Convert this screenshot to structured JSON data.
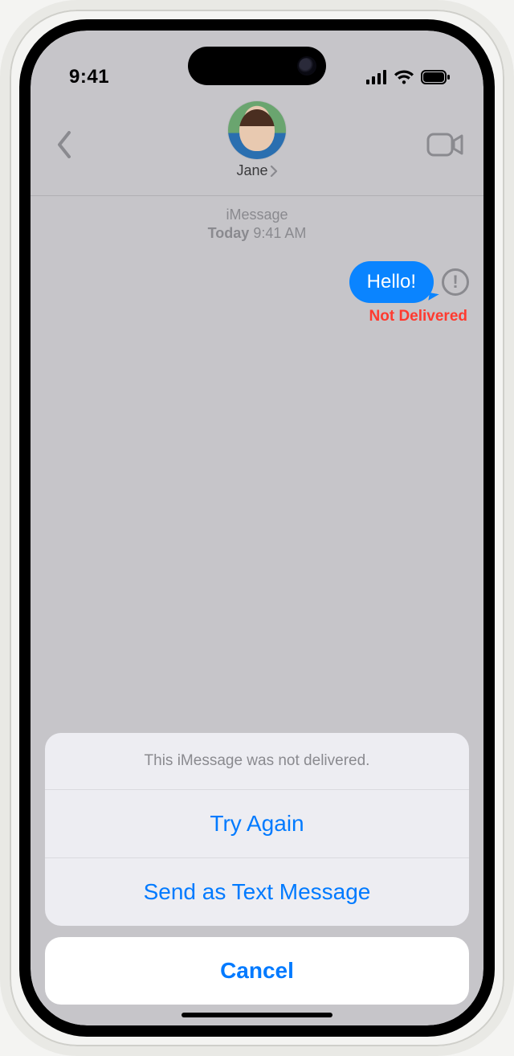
{
  "status": {
    "time": "9:41"
  },
  "header": {
    "contact_name": "Jane"
  },
  "thread": {
    "service": "iMessage",
    "day": "Today",
    "time": "9:41 AM"
  },
  "message": {
    "text": "Hello!",
    "status": "Not Delivered"
  },
  "sheet": {
    "title": "This iMessage was not delivered.",
    "try_again": "Try Again",
    "send_as_text": "Send as Text Message",
    "cancel": "Cancel"
  }
}
